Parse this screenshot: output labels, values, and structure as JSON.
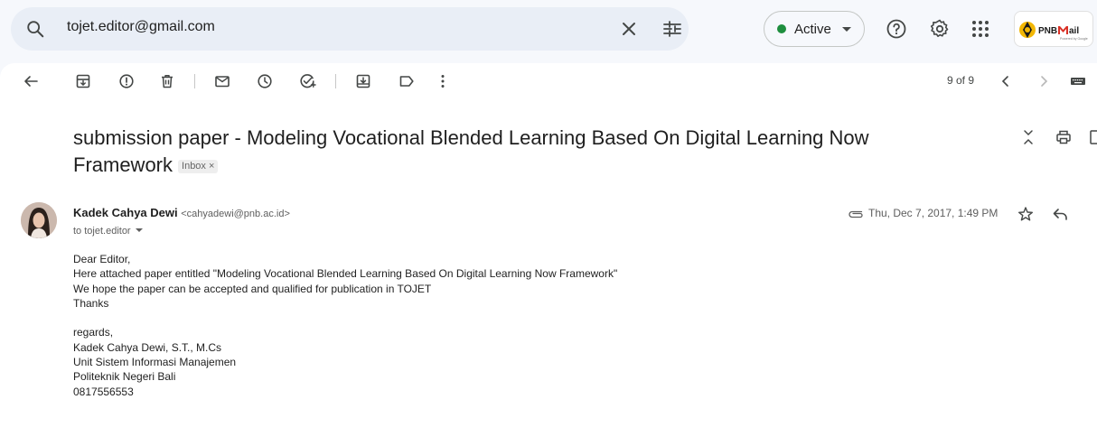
{
  "search": {
    "value": "tojet.editor@gmail.com"
  },
  "status": {
    "label": "Active",
    "dot_color": "#1e8e3e"
  },
  "brand": {
    "name": "PNB",
    "mail": "Mail",
    "sub": "Powered by Google"
  },
  "toolbar": {
    "pager": "9 of 9"
  },
  "email": {
    "subject": "submission paper - Modeling Vocational Blended Learning Based On Digital Learning Now Framework",
    "label": "Inbox",
    "label_close": "×",
    "sender_name": "Kadek Cahya Dewi",
    "sender_email": "<cahyadewi@pnb.ac.id>",
    "to": "to tojet.editor",
    "date": "Thu, Dec 7, 2017, 1:49 PM",
    "body": [
      "Dear Editor,",
      "Here attached paper entitled \"Modeling Vocational Blended Learning Based On Digital Learning Now Framework\"",
      "We hope the paper can be accepted and qualified for publication in TOJET",
      "Thanks",
      "",
      "regards,",
      "Kadek Cahya Dewi, S.T., M.Cs",
      "Unit Sistem Informasi Manajemen",
      "Politeknik Negeri Bali",
      "0817556553"
    ]
  }
}
